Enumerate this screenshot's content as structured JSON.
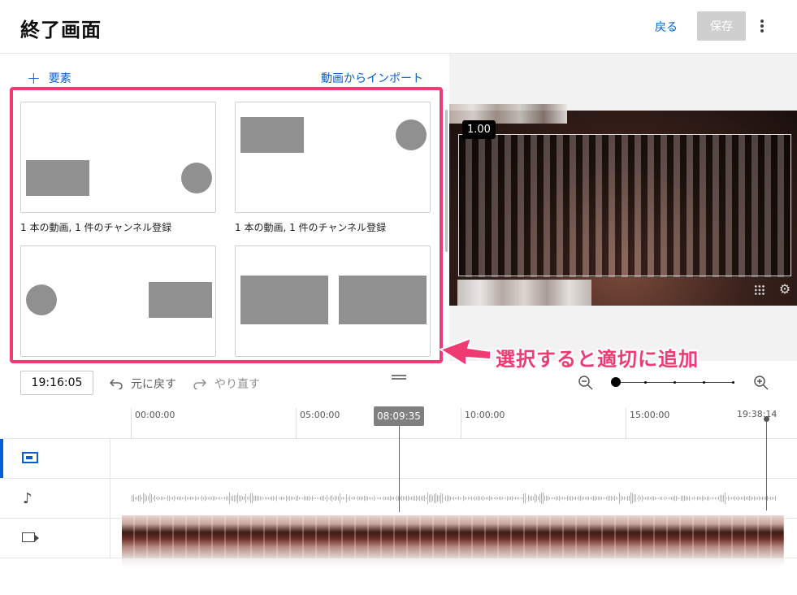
{
  "header": {
    "title": "終了画面",
    "back_label": "戻る",
    "save_label": "保存"
  },
  "panel": {
    "add_element": "要素",
    "import_label": "動画からインポート",
    "templates": [
      {
        "label": "1 本の動画, 1 件のチャンネル登録"
      },
      {
        "label": "1 本の動画, 1 件のチャンネル登録"
      },
      {
        "label": ""
      },
      {
        "label": ""
      }
    ]
  },
  "preview": {
    "badge": "1.00"
  },
  "annotation": {
    "text": "選択すると適切に追加",
    "color": "#f03a72"
  },
  "toolbar": {
    "timecode": "19:16:05",
    "undo_label": "元に戻す",
    "redo_label": "やり直す"
  },
  "timeline": {
    "ticks": [
      "00:00:00",
      "05:00:00",
      "10:00:00",
      "15:00:00"
    ],
    "playhead": "08:09:35",
    "end_time": "19:38:14"
  },
  "colors": {
    "accent": "#065fd4",
    "highlight": "#f03a72"
  },
  "icons": [
    "plus-icon",
    "kebab-icon",
    "grid-icon",
    "gear-icon",
    "undo-icon",
    "redo-icon",
    "zoom-out-icon",
    "zoom-in-icon",
    "endscreen-icon",
    "music-note-icon",
    "video-icon"
  ]
}
